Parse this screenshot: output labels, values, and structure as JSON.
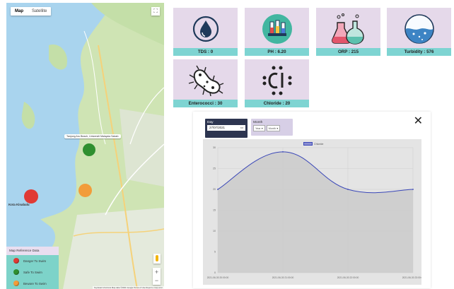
{
  "map": {
    "type_tabs": [
      "Map",
      "Satellite"
    ],
    "active_type": "Map",
    "fullscreen_icon": "fullscreen-icon",
    "tooltip": "Tanjung Aru Beach, Universiti Malaysia Sabah",
    "places": [
      "Kota Kinabalu"
    ],
    "zoom_in": "+",
    "zoom_out": "−",
    "attribution": "Keyboard shortcuts  Map data ©2021 Google  Terms of Use  Report a map error",
    "markers": [
      {
        "status": "safe",
        "color": "#2f8f2f"
      },
      {
        "status": "beware",
        "color": "#f29c3a"
      },
      {
        "status": "danger",
        "color": "#e03a35"
      }
    ]
  },
  "legend": {
    "title": "Map Reference Data",
    "items": [
      {
        "label": "Danger To Swim",
        "color": "#e03a35"
      },
      {
        "label": "Safe To Swim",
        "color": "#2f8f2f"
      },
      {
        "label": "Beware To Swim",
        "color": "#f29c3a"
      }
    ]
  },
  "cards": [
    {
      "label": "TDS : 0",
      "icon": "water-drop-icon"
    },
    {
      "label": "PH : 6.20",
      "icon": "ph-test-tubes-icon"
    },
    {
      "label": "ORP : 215",
      "icon": "chemistry-flasks-icon"
    },
    {
      "label": "Turbidity : 576",
      "icon": "turbidity-water-icon"
    },
    {
      "label": "Enterococci : 30",
      "icon": "bacteria-icon"
    },
    {
      "label": "Chloride : 20",
      "icon": "chloride-icon"
    }
  ],
  "filters": {
    "day_label": "Day",
    "day_value": "27/07/2021",
    "month_label": "Month",
    "year_placeholder": "Year",
    "month_placeholder": "Month",
    "close_icon": "close-icon"
  },
  "colors": {
    "card_bg": "#e5d9ea",
    "card_caption": "#7ed4d2",
    "legend_bg": "#7dd3c9",
    "day_box": "#2d3550",
    "line": "#3a47b8"
  },
  "chart_data": {
    "type": "area",
    "title": "",
    "xlabel": "",
    "ylabel": "",
    "series": [
      {
        "name": "Chloride",
        "x": [
          "2021-06-30 20:00:00",
          "2021-06-30 21:00:00",
          "2021-06-30 22:00:00",
          "2021-06-30 23:00:00"
        ],
        "values": [
          20,
          29,
          20,
          20
        ]
      }
    ],
    "x_ticks": [
      "2021-06-30 20:00:00",
      "2021-06-30 21:00:00",
      "2021-06-30 22:00:00",
      "2021-06-30 23:00:00"
    ],
    "y_ticks": [
      0,
      5,
      10,
      15,
      20,
      25,
      30
    ],
    "ylim": [
      0,
      30
    ],
    "grid": true,
    "legend": "top-center"
  }
}
